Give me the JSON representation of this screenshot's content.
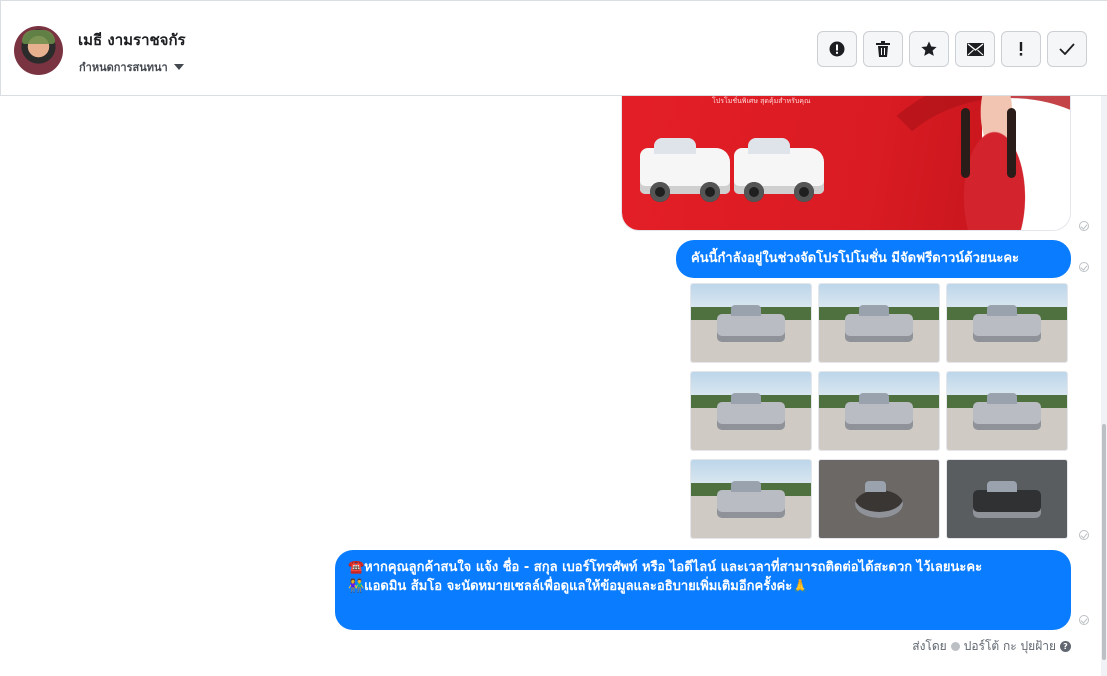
{
  "header": {
    "contact_name": "เมธี งามราชจกัร",
    "assign_label": "กำหนดการสนทนา",
    "toolbar": [
      {
        "icon": "alert-circle-icon"
      },
      {
        "icon": "trash-icon"
      },
      {
        "icon": "star-icon"
      },
      {
        "icon": "envelope-icon"
      },
      {
        "icon": "exclamation-icon"
      },
      {
        "icon": "checkmark-icon"
      }
    ]
  },
  "messages": {
    "promo_image": {
      "caption": "โปรโมชั่นพิเศษ สุดคุ้มสำหรับคุณ"
    },
    "bubble1": "คันนี้กำลังอยู่ในช่วงจัดโปรโปโมชั่น มีจัดฟรีดาวน์ด้วยนะคะ",
    "photo_count": 9,
    "bubble2_line1": "☎️หากคุณลูกค้าสนใจ แจ้ง ชื่อ - สกุล เบอร์โทรศัพท์ หรือ ไอดีไลน์ และเวลาที่สามารถติดต่อได้สะดวก ไว้เลยนะคะ",
    "bubble2_line2": "👫แอดมิน ส้มโอ จะนัดหมายเซลล์เพื่อดูแลให้ข้อมูลและอธิบายเพิ่มเติมอีกครั้งค่ะ🙏"
  },
  "footer": {
    "sent_by_label": "ส่งโดย",
    "sender_name": "ปอร์โต้ กะ ปุยฝ้าย",
    "help_symbol": "?"
  },
  "colors": {
    "bubble": "#0a7cff",
    "promo_red": "#e41e26",
    "toolbar_bg": "#f5f6f7"
  }
}
